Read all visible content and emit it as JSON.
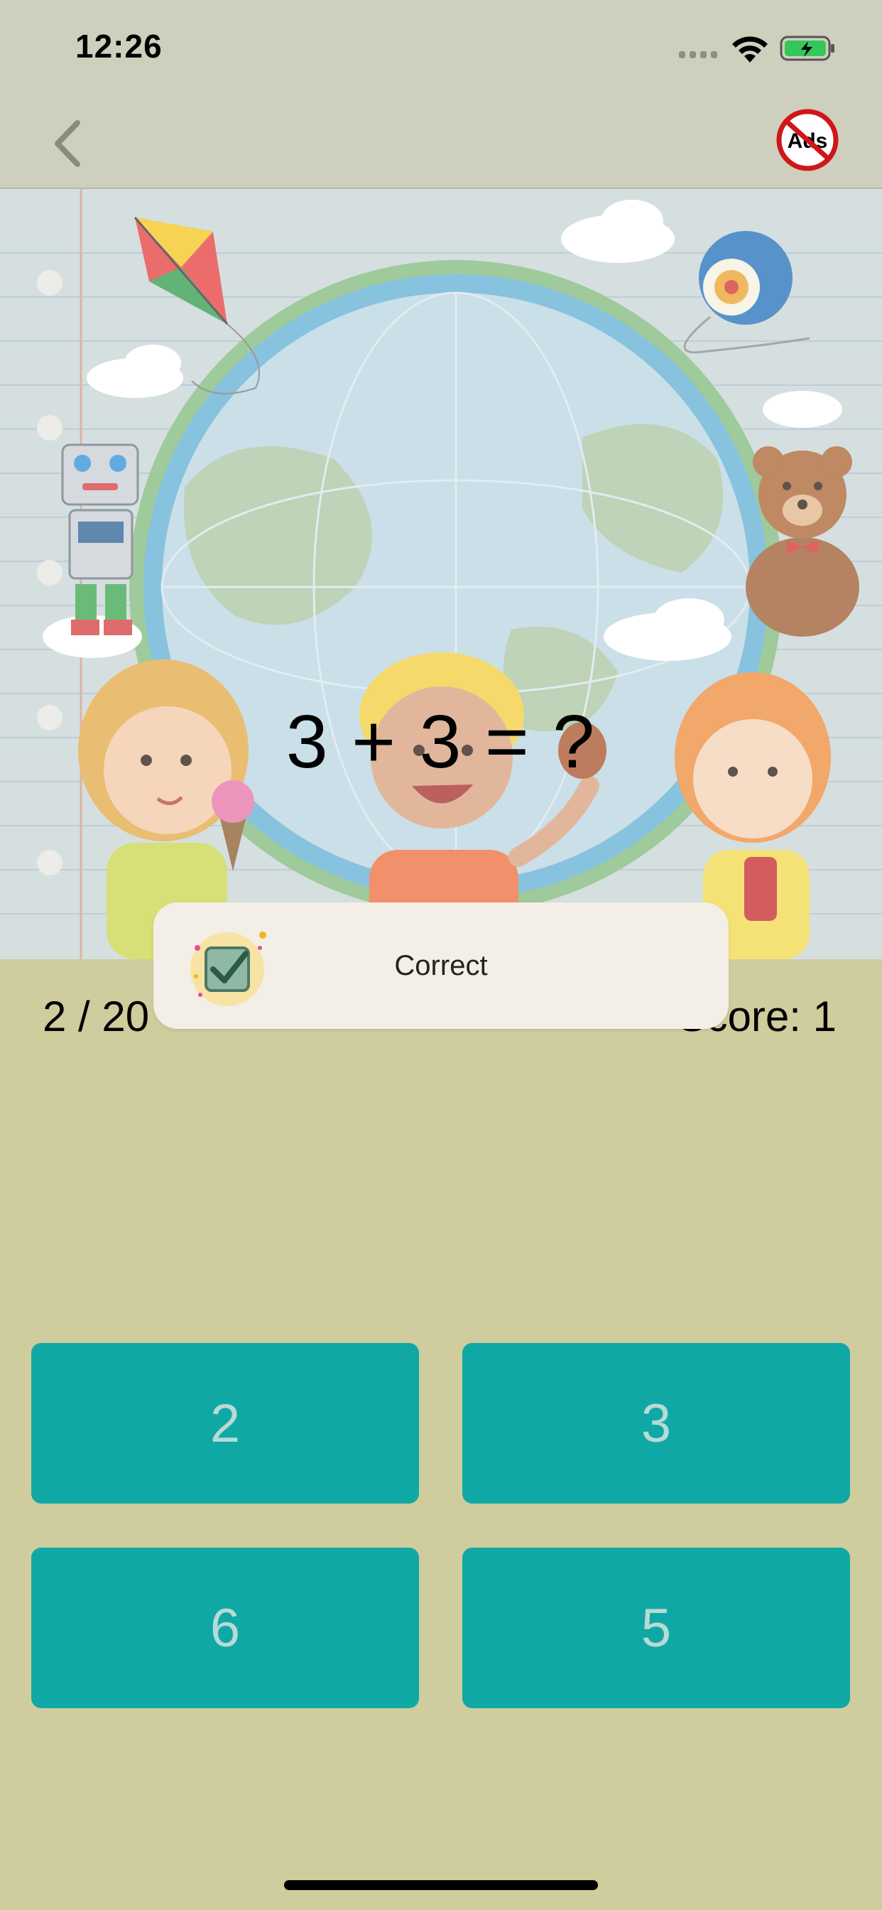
{
  "status_bar": {
    "time": "12:26"
  },
  "nav": {
    "back_icon": "chevron-left-icon",
    "noads_label": "Ads",
    "noads_icon": "no-ads-icon"
  },
  "question": {
    "text": "3 + 3 = ?"
  },
  "progress": {
    "text": "2 / 20"
  },
  "score": {
    "text": "Score: 1"
  },
  "toast": {
    "text": "Correct",
    "icon": "checkbox-checked-icon"
  },
  "answers": [
    {
      "label": "2"
    },
    {
      "label": "3"
    },
    {
      "label": "6"
    },
    {
      "label": "5"
    }
  ],
  "colors": {
    "background": "#cfcc9e",
    "answer_button": "#10a8a5",
    "answer_text": "#b8dad6",
    "toast_background": "#f3efe6",
    "battery_fill": "#34c759"
  }
}
